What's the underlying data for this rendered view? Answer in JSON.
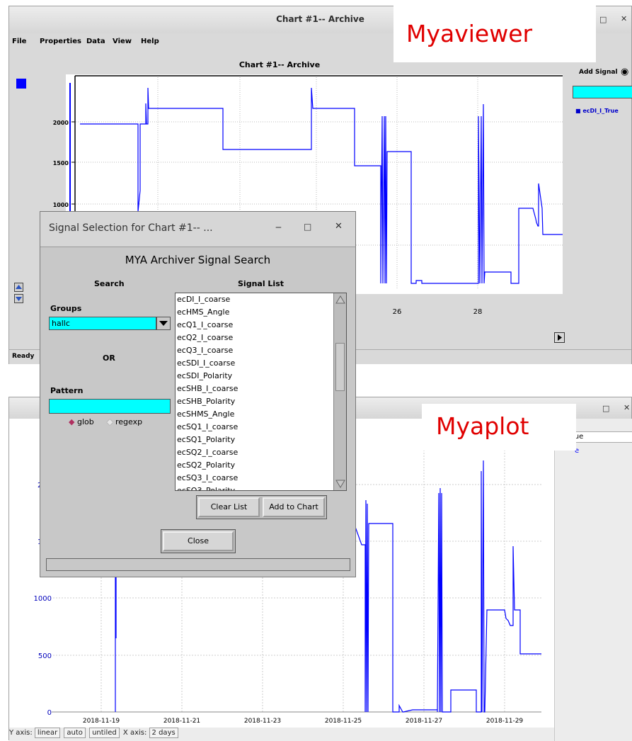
{
  "myaviewer": {
    "window_title": "Chart #1-- Archive",
    "menu": [
      "File",
      "Properties",
      "Data",
      "View",
      "Help"
    ],
    "chart_title": "Chart #1-- Archive",
    "add_signal_label": "Add Signal",
    "signal_legend": "ecDI_I_True",
    "status": "Ready",
    "yticks": [
      "2000",
      "1500",
      "1000"
    ],
    "xticks": [
      "26",
      "28"
    ],
    "accent_color": "#0000ff",
    "overlay_label": "Myaviewer"
  },
  "dialog": {
    "window_title": "Signal Selection for Chart #1-- ...",
    "heading": "MYA Archiver Signal Search",
    "search_label": "Search",
    "signal_list_label": "Signal List",
    "groups_label": "Groups",
    "groups_value": "hallc",
    "or_label": "OR",
    "pattern_label": "Pattern",
    "pattern_value": "",
    "radio_glob": "glob",
    "radio_regexp": "regexp",
    "signals": [
      "ecDI_I_coarse",
      "ecHMS_Angle",
      "ecQ1_I_coarse",
      "ecQ2_I_coarse",
      "ecQ3_I_coarse",
      "ecSDI_I_coarse",
      "ecSDI_Polarity",
      "ecSHB_I_coarse",
      "ecSHB_Polarity",
      "ecSHMS_Angle",
      "ecSQ1_I_coarse",
      "ecSQ1_Polarity",
      "ecSQ2_I_coarse",
      "ecSQ2_Polarity",
      "ecSQ3_I_coarse",
      "ecSQ3_Polarity"
    ],
    "clear_list_label": "Clear List",
    "add_to_chart_label": "Add to Chart",
    "close_label": "Close"
  },
  "myaplot": {
    "overlay_label": "Myaplot",
    "legend_field": "True",
    "legend_text": "e",
    "yticks": [
      "1000",
      "500",
      "0"
    ],
    "partial_yticks": [
      "2",
      "1"
    ],
    "xticks": [
      "2018-11-19",
      "2018-11-21",
      "2018-11-23",
      "2018-11-25",
      "2018-11-27",
      "2018-11-29"
    ],
    "status": {
      "y_axis_label": "Y axis:",
      "y_scale": "linear",
      "y_range": "auto",
      "y_title": "untiled",
      "x_axis_label": "X axis:",
      "x_span": "2 days"
    }
  },
  "chart_data": [
    {
      "type": "line",
      "title": "Chart #1-- Archive",
      "series": [
        {
          "name": "ecDI_I_True",
          "color": "#0000ff"
        }
      ],
      "x_tick_labels": [
        "26",
        "28"
      ],
      "y_tick_labels": [
        "2000",
        "1500",
        "1000"
      ],
      "grid": true
    },
    {
      "type": "line",
      "x_tick_labels": [
        "2018-11-19",
        "2018-11-21",
        "2018-11-23",
        "2018-11-25",
        "2018-11-27",
        "2018-11-29"
      ],
      "y_tick_labels": [
        "1000",
        "500",
        "0"
      ],
      "ylim": [
        0,
        2300
      ],
      "grid": true,
      "series": [
        {
          "color": "#0000ff",
          "x": [
            "2018-11-18 00:00",
            "2018-11-19 00:00",
            "2018-11-19 00:00",
            "2018-11-19 00:00",
            "2018-11-19 00:00",
            "2018-11-19 00:00",
            "2018-11-19 00:00",
            "2018-11-19 00:00",
            "2018-11-25 12:00",
            "2018-11-25 14:00",
            "2018-11-25 14:00",
            "2018-11-25 16:00",
            "2018-11-25 16:00",
            "2018-11-25 18:00",
            "2018-11-25 18:00",
            "2018-11-26 12:00",
            "2018-11-26 12:00",
            "2018-11-26 14:00",
            "2018-11-26 14:00",
            "2018-11-26 16:00",
            "2018-11-26 16:00",
            "2018-11-26 20:00",
            "2018-11-26 20:00",
            "2018-11-27 18:00",
            "2018-11-27 18:00",
            "2018-11-28 00:00",
            "2018-11-28 00:00",
            "2018-11-28 02:00",
            "2018-11-28 02:00",
            "2018-11-28 08:00",
            "2018-11-28 08:00",
            "2018-11-28 14:00",
            "2018-11-28 14:00",
            "2018-11-28 22:00",
            "2018-11-28 22:00",
            "2018-11-29 04:00",
            "2018-11-29 06:00",
            "2018-11-29 08:00",
            "2018-11-29 08:00",
            "2018-11-29 12:00",
            "2018-11-29 12:00",
            "2018-11-29 16:00",
            "2018-11-29 16:00",
            "2018-11-30 00:00"
          ],
          "y": [
            1960,
            1960,
            0,
            1200,
            700,
            1200,
            1960,
            1960,
            1960,
            1960,
            0,
            1850,
            0,
            1650,
            1650,
            1650,
            0,
            1650,
            0,
            100,
            0,
            0,
            20,
            20,
            0,
            0,
            1950,
            1950,
            0,
            0,
            170,
            170,
            0,
            0,
            920,
            920,
            860,
            860,
            1400,
            920,
            1520,
            920,
            620,
            620
          ]
        }
      ]
    }
  ]
}
